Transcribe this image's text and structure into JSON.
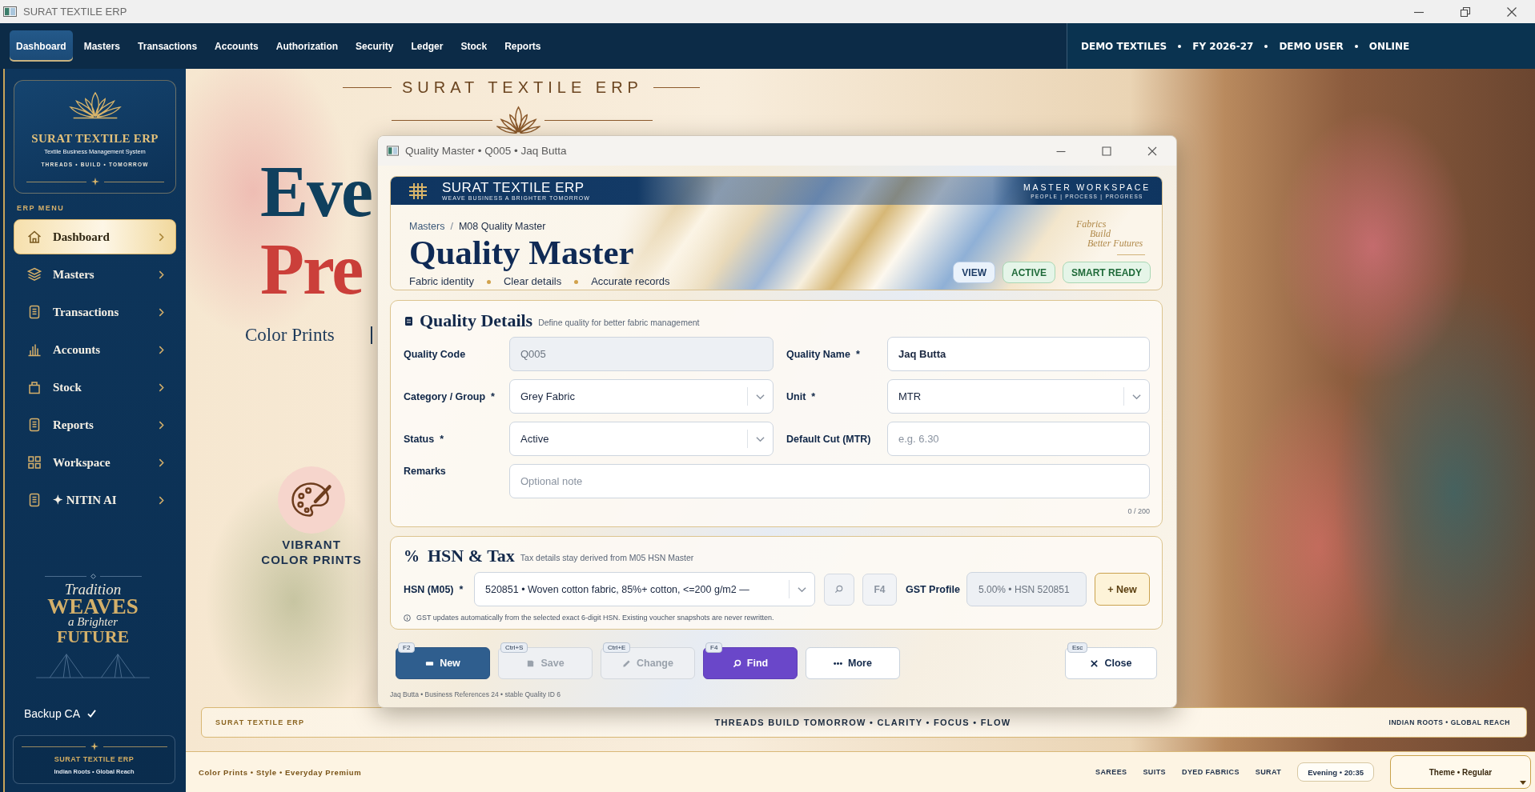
{
  "window": {
    "title": "SURAT TEXTILE ERP"
  },
  "nav": {
    "tabs": [
      {
        "label": "Dashboard",
        "selected": true
      },
      {
        "label": "Masters",
        "selected": false
      },
      {
        "label": "Transactions",
        "selected": false
      },
      {
        "label": "Accounts",
        "selected": false
      },
      {
        "label": "Authorization",
        "selected": false
      },
      {
        "label": "Security",
        "selected": false
      },
      {
        "label": "Ledger",
        "selected": false
      },
      {
        "label": "Stock",
        "selected": false
      },
      {
        "label": "Reports",
        "selected": false
      }
    ],
    "session": [
      "DEMO TEXTILES",
      "FY 2026-27",
      "DEMO USER",
      "ONLINE"
    ]
  },
  "sidebar": {
    "brand": {
      "title": "SURAT TEXTILE ERP",
      "subtitle": "Textile Business Management System",
      "tagline": "THREADS • BUILD • TOMORROW"
    },
    "menu_title": "ERP MENU",
    "items": [
      {
        "label": "Dashboard",
        "selected": true
      },
      {
        "label": "Masters",
        "selected": false
      },
      {
        "label": "Transactions",
        "selected": false
      },
      {
        "label": "Accounts",
        "selected": false
      },
      {
        "label": "Stock",
        "selected": false
      },
      {
        "label": "Reports",
        "selected": false
      },
      {
        "label": "Workspace",
        "selected": false
      },
      {
        "label": "✦ NITIN AI",
        "selected": false
      }
    ],
    "motto": [
      "Tradition",
      "WEAVES",
      "a Brighter",
      "FUTURE"
    ],
    "backup": {
      "label": "Backup CA",
      "verified": true
    },
    "footer": {
      "title": "SURAT TEXTILE ERP",
      "tagline": "Indian Roots • Global Reach"
    }
  },
  "hero": {
    "heading": "SURAT TEXTILE ERP",
    "headline": [
      "Eve",
      "Pre"
    ],
    "subline": "Color Prints",
    "feature": "VIBRANT COLOR PRINTS"
  },
  "dialog": {
    "title": "Quality Master • Q005 • Jaq Butta",
    "banner": {
      "brand": "SURAT TEXTILE ERP",
      "brand_tagline": "WEAVE BUSINESS A BRIGHTER TOMORROW",
      "workspace": "MASTER WORKSPACE",
      "workspace_tagline": "PEOPLE | PROCESS | PROGRESS",
      "breadcrumb": [
        "Masters",
        "M08 Quality Master"
      ],
      "breadcrumb_separator": "/",
      "heading": "Quality Master",
      "highlights": [
        "Fabric identity",
        "Clear details",
        "Accurate records"
      ],
      "motto": [
        "Fabrics",
        "Build",
        "Better Futures"
      ],
      "badges": [
        {
          "label": "VIEW",
          "kind": "info"
        },
        {
          "label": "ACTIVE",
          "kind": "success"
        },
        {
          "label": "SMART READY",
          "kind": "success"
        }
      ]
    },
    "details": {
      "title": "Quality Details",
      "subtitle": "Define quality for better fabric management",
      "fields": [
        {
          "label": "Quality Code",
          "kind": "readonly",
          "value": "Q005"
        },
        {
          "label": "Quality Name",
          "marker": "*",
          "kind": "text",
          "value": "Jaq Butta"
        },
        {
          "label": "Category / Group",
          "marker": "*",
          "kind": "select",
          "value": "Grey Fabric"
        },
        {
          "label": "Unit",
          "marker": "*",
          "kind": "select",
          "value": "MTR"
        },
        {
          "label": "Status",
          "marker": "*",
          "kind": "select",
          "value": "Active"
        },
        {
          "label": "Default Cut (MTR)",
          "kind": "text",
          "placeholder": "e.g. 6.30"
        },
        {
          "label": "Remarks",
          "kind": "textarea",
          "placeholder": "Optional note"
        }
      ],
      "counter": "0 / 200"
    },
    "tax": {
      "symbol": "%",
      "title": "HSN & Tax",
      "subtitle": "Tax details stay derived from M05 HSN Master",
      "hsn": {
        "label": "HSN (M05)",
        "marker": "*",
        "value": "520851 • Woven cotton fabric, 85%+ cotton, <=200 g/m2 —"
      },
      "lookup_key": "F4",
      "gst": {
        "label": "GST Profile",
        "value": "5.00% • HSN 520851"
      },
      "new_label": "+ New",
      "note": "GST updates automatically from the selected exact 6-digit HSN. Existing voucher snapshots are never rewritten."
    },
    "actions": [
      {
        "label": "New",
        "shortcut": "F2",
        "kind": "new",
        "disabled": false
      },
      {
        "label": "Save",
        "shortcut": "Ctrl+S",
        "kind": "save",
        "disabled": true
      },
      {
        "label": "Change",
        "shortcut": "Ctrl+E",
        "kind": "change",
        "disabled": true
      },
      {
        "label": "Find",
        "shortcut": "F4",
        "kind": "find",
        "disabled": false
      },
      {
        "label": "More",
        "kind": "more",
        "disabled": false
      },
      {
        "label": "Close",
        "shortcut": "Esc",
        "kind": "close",
        "disabled": false
      }
    ],
    "status": "Jaq Butta • Business References 24 • stable Quality ID 6"
  },
  "strip": {
    "brand": "SURAT TEXTILE ERP",
    "values": "THREADS BUILD TOMORROW • CLARITY • FOCUS • FLOW",
    "reach": "INDIAN ROOTS • GLOBAL REACH"
  },
  "footer": {
    "tagline": "Color Prints • Style • Everyday Premium",
    "links": [
      "SAREES",
      "SUITS",
      "DYED FABRICS",
      "SURAT"
    ],
    "clock": "Evening • 20:35",
    "theme": "Theme • Regular"
  }
}
